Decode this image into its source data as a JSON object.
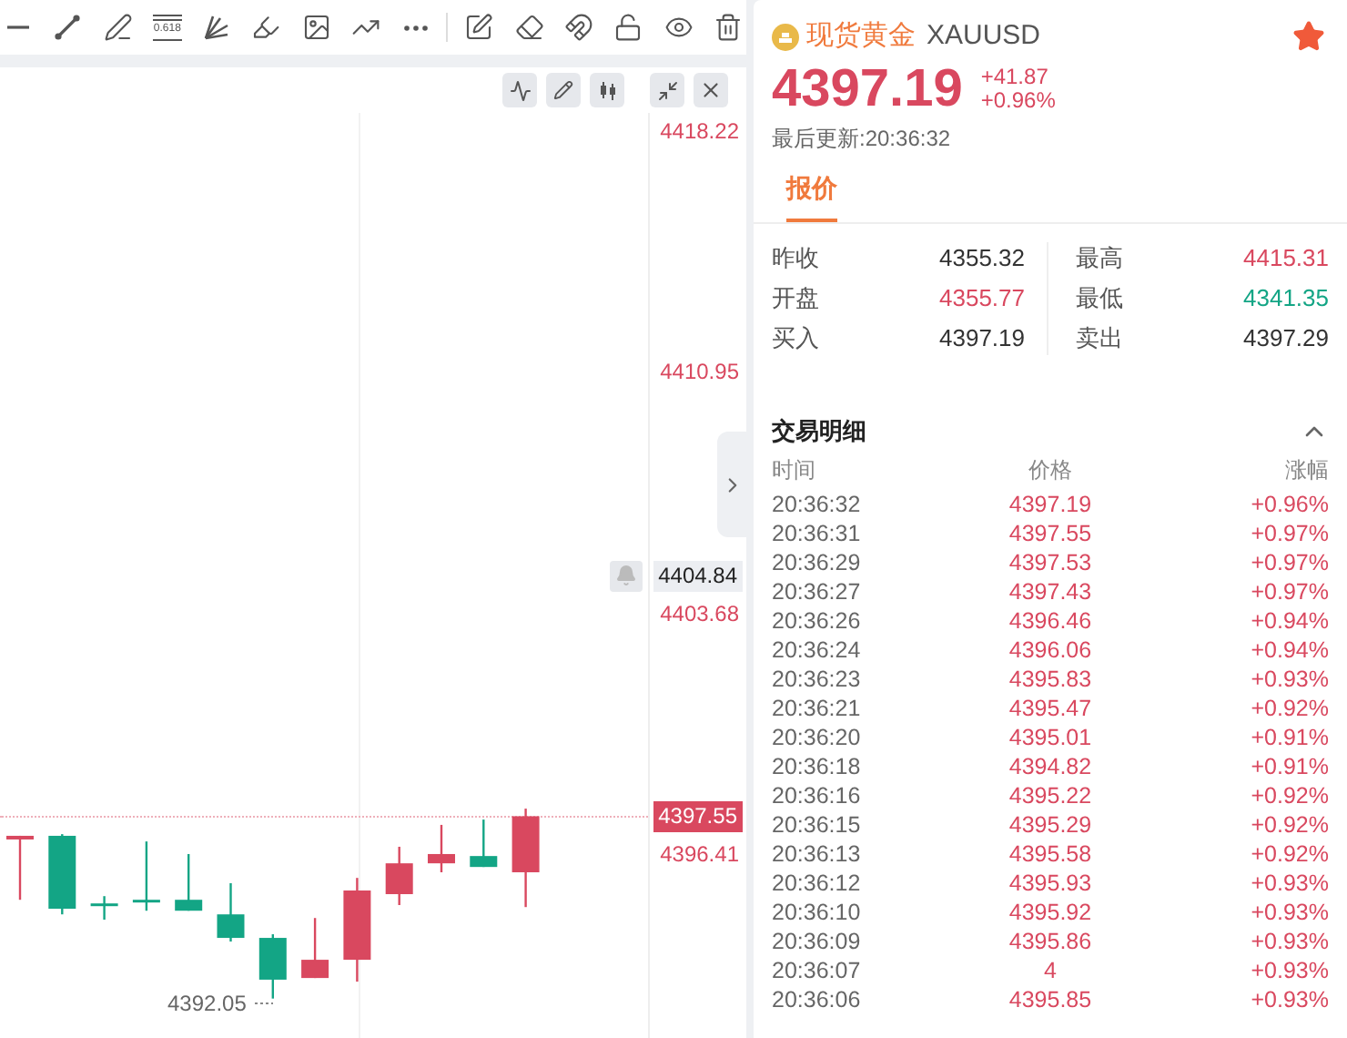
{
  "toolbar": {
    "fib_label": "0.618"
  },
  "chart": {
    "axis_labels": [
      {
        "text": "4404.84",
        "kind": "current"
      },
      {
        "text": "4397.55",
        "kind": "last"
      }
    ],
    "low_label": "4392.05",
    "chart_data": {
      "type": "candlestick",
      "ylim": [
        4390.86,
        4418.77
      ],
      "yticks": [
        {
          "value": 4418.22,
          "label": "4418.22"
        },
        {
          "value": 4410.95,
          "label": "4410.95"
        },
        {
          "value": 4403.68,
          "label": "4403.68"
        },
        {
          "value": 4396.41,
          "label": "4396.41"
        }
      ],
      "ohlc": [
        [
          4396.85,
          4396.96,
          4395.03,
          4396.96
        ],
        [
          4396.96,
          4397.01,
          4394.59,
          4394.76
        ],
        [
          4394.92,
          4395.14,
          4394.43,
          4394.87
        ],
        [
          4395.03,
          4396.79,
          4394.7,
          4394.98
        ],
        [
          4395.03,
          4396.41,
          4394.7,
          4394.7
        ],
        [
          4394.59,
          4395.53,
          4393.77,
          4393.88
        ],
        [
          4393.88,
          4393.99,
          4392.05,
          4392.62
        ],
        [
          4392.67,
          4394.48,
          4392.67,
          4393.22
        ],
        [
          4393.22,
          4395.69,
          4392.56,
          4395.31
        ],
        [
          4395.2,
          4396.63,
          4394.87,
          4396.13
        ],
        [
          4396.13,
          4397.29,
          4395.86,
          4396.41
        ],
        [
          4396.35,
          4397.45,
          4396.02,
          4396.02
        ],
        [
          4395.86,
          4397.78,
          4394.81,
          4397.55
        ]
      ]
    }
  },
  "quote": {
    "name": "现货黄金",
    "symbol": "XAUUSD",
    "favorite": true,
    "price": "4397.19",
    "change": "+41.87",
    "change_pct": "+0.96%",
    "updated": "最后更新:20:36:32"
  },
  "tabs": [
    {
      "label": "报价",
      "selected": true
    }
  ],
  "stats": [
    {
      "label": "昨收",
      "value": "4355.32",
      "color": "#333333"
    },
    {
      "label": "最高",
      "value": "4415.31",
      "color": "#d9485f"
    },
    {
      "label": "开盘",
      "value": "4355.77",
      "color": "#d9485f"
    },
    {
      "label": "最低",
      "value": "4341.35",
      "color": "#13a585"
    },
    {
      "label": "买入",
      "value": "4397.19",
      "color": "#333333"
    },
    {
      "label": "卖出",
      "value": "4397.29",
      "color": "#333333"
    }
  ],
  "trades": {
    "title": "交易明细",
    "expanded": true,
    "columns": [
      "时间",
      "价格",
      "涨幅"
    ],
    "rows": [
      {
        "time": "20:36:32",
        "price": "4397.19",
        "change": "+0.96%"
      },
      {
        "time": "20:36:31",
        "price": "4397.55",
        "change": "+0.97%"
      },
      {
        "time": "20:36:29",
        "price": "4397.53",
        "change": "+0.97%"
      },
      {
        "time": "20:36:27",
        "price": "4397.43",
        "change": "+0.97%"
      },
      {
        "time": "20:36:26",
        "price": "4396.46",
        "change": "+0.94%"
      },
      {
        "time": "20:36:24",
        "price": "4396.06",
        "change": "+0.94%"
      },
      {
        "time": "20:36:23",
        "price": "4395.83",
        "change": "+0.93%"
      },
      {
        "time": "20:36:21",
        "price": "4395.47",
        "change": "+0.92%"
      },
      {
        "time": "20:36:20",
        "price": "4395.01",
        "change": "+0.91%"
      },
      {
        "time": "20:36:18",
        "price": "4394.82",
        "change": "+0.91%"
      },
      {
        "time": "20:36:16",
        "price": "4395.22",
        "change": "+0.92%"
      },
      {
        "time": "20:36:15",
        "price": "4395.29",
        "change": "+0.92%"
      },
      {
        "time": "20:36:13",
        "price": "4395.58",
        "change": "+0.92%"
      },
      {
        "time": "20:36:12",
        "price": "4395.93",
        "change": "+0.93%"
      },
      {
        "time": "20:36:10",
        "price": "4395.92",
        "change": "+0.93%"
      },
      {
        "time": "20:36:09",
        "price": "4395.86",
        "change": "+0.93%"
      },
      {
        "time": "20:36:07",
        "price": "4",
        "change": "+0.93%"
      },
      {
        "time": "20:36:06",
        "price": "4395.85",
        "change": "+0.93%"
      }
    ]
  }
}
